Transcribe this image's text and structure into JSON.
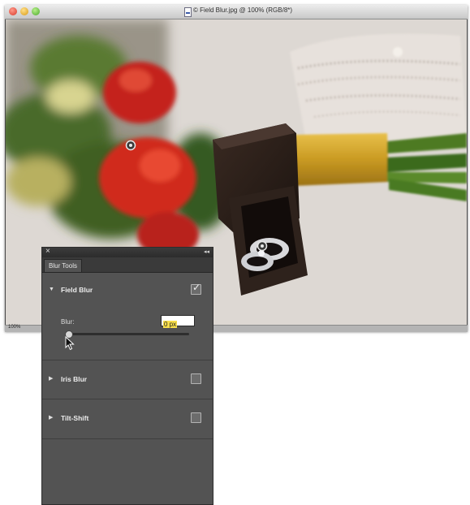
{
  "window": {
    "title": "© Field Blur.jpg @ 100% (RGB/8*)",
    "zoom": "100%"
  },
  "panel": {
    "tab": "Blur Tools",
    "close_glyph": "×",
    "collapse_glyph": "◂◂",
    "sections": [
      {
        "title": "Field Blur",
        "expanded": true,
        "checked": true
      },
      {
        "title": "Iris Blur",
        "expanded": false,
        "checked": false
      },
      {
        "title": "Tilt-Shift",
        "expanded": false,
        "checked": false
      }
    ],
    "blur": {
      "label": "Blur:",
      "value": "0 px",
      "slider_fraction": 0
    }
  },
  "icons": [
    "close-icon",
    "collapse-icon",
    "expanded-arrow-icon",
    "collapsed-arrow-icon",
    "checkmark-icon",
    "blur-pin-icon",
    "mouse-cursor-icon",
    "document-icon"
  ],
  "colors": {
    "input_highlight": "#f7de4a",
    "panel_bg": "#535353"
  }
}
